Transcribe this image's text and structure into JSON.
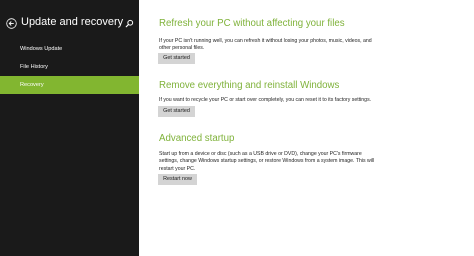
{
  "header": {
    "title": "Update and recovery",
    "back_icon": "back-arrow-icon",
    "search_icon": "search-icon"
  },
  "sidebar": {
    "items": [
      {
        "label": "Windows Update",
        "active": false
      },
      {
        "label": "File History",
        "active": false
      },
      {
        "label": "Recovery",
        "active": true
      }
    ]
  },
  "sections": [
    {
      "title": "Refresh your PC without affecting your files",
      "description": "If your PC isn't running well, you can refresh it without losing your photos, music, videos, and other personal files.",
      "button": "Get started"
    },
    {
      "title": "Remove everything and reinstall Windows",
      "description": "If you want to recycle your PC or start over completely, you can reset it to its factory settings.",
      "button": "Get started"
    },
    {
      "title": "Advanced startup",
      "description": "Start up from a device or disc (such as a USB drive or DVD), change your PC's firmware settings, change Windows startup settings, or restore Windows from a system image. This will restart your PC.",
      "button": "Restart now"
    }
  ],
  "colors": {
    "sidebar_bg": "#1a1a1a",
    "accent": "#82b630",
    "heading": "#7fb23a",
    "button_bg": "#d4d4d4"
  }
}
